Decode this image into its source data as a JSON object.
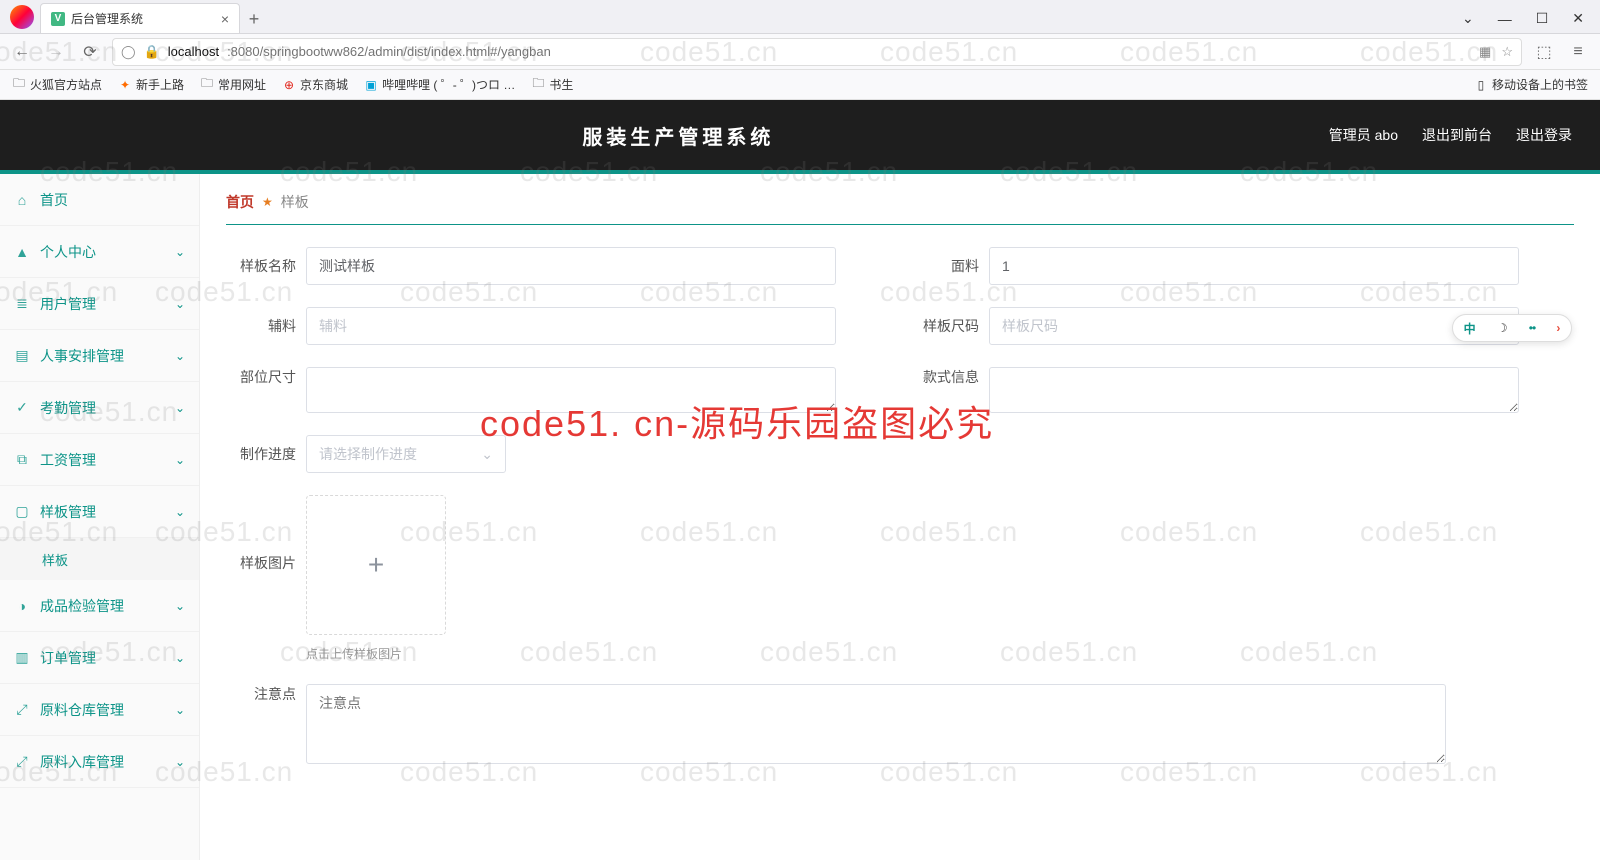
{
  "browser": {
    "tab_title": "后台管理系统",
    "url_host": "localhost",
    "url_path": ":8080/springbootww862/admin/dist/index.html#/yangban",
    "bookmarks": [
      "火狐官方站点",
      "新手上路",
      "常用网址",
      "京东商城",
      "哔哩哔哩 (  ゜- ゜)つロ …",
      "书生"
    ],
    "bookmark_right": "移动设备上的书签"
  },
  "header": {
    "title": "服装生产管理系统",
    "user": "管理员 abo",
    "exit_front": "退出到前台",
    "logout": "退出登录"
  },
  "sidebar": {
    "items": [
      {
        "label": "首页",
        "icon": "home",
        "expandable": false
      },
      {
        "label": "个人中心",
        "icon": "user",
        "expandable": true
      },
      {
        "label": "用户管理",
        "icon": "users",
        "expandable": true
      },
      {
        "label": "人事安排管理",
        "icon": "clipboard",
        "expandable": true
      },
      {
        "label": "考勤管理",
        "icon": "check",
        "expandable": true
      },
      {
        "label": "工资管理",
        "icon": "copy",
        "expandable": true
      },
      {
        "label": "样板管理",
        "icon": "template",
        "expandable": true,
        "open": true,
        "children": [
          "样板"
        ]
      },
      {
        "label": "成品检验管理",
        "icon": "verify",
        "expandable": true
      },
      {
        "label": "订单管理",
        "icon": "bars",
        "expandable": true
      },
      {
        "label": "原料仓库管理",
        "icon": "expand",
        "expandable": true
      },
      {
        "label": "原料入库管理",
        "icon": "expand",
        "expandable": true
      }
    ]
  },
  "breadcrumb": {
    "home": "首页",
    "current": "样板"
  },
  "form": {
    "name_label": "样板名称",
    "name_value": "测试样板",
    "mianliao_label": "面料",
    "mianliao_value": "1",
    "fuliao_label": "辅料",
    "fuliao_placeholder": "辅料",
    "size_code_label": "样板尺码",
    "size_code_placeholder": "样板尺码",
    "part_size_label": "部位尺寸",
    "style_info_label": "款式信息",
    "progress_label": "制作进度",
    "progress_placeholder": "请选择制作进度",
    "image_label": "样板图片",
    "upload_hint": "点击上传样板图片",
    "notes_label": "注意点",
    "notes_placeholder": "注意点"
  },
  "ime": {
    "cn": "中"
  },
  "watermark_text": "code51.cn",
  "big_watermark": "code51. cn-源码乐园盗图必究"
}
